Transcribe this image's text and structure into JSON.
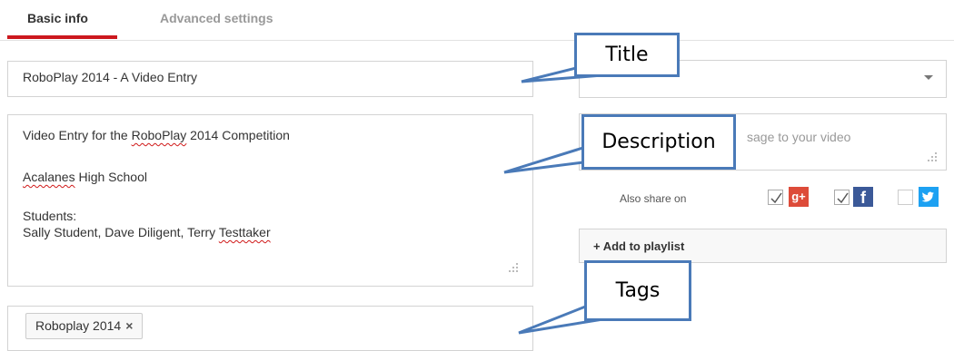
{
  "tabs": [
    {
      "label": "Basic info",
      "active": true
    },
    {
      "label": "Advanced settings",
      "active": false
    }
  ],
  "title_field": {
    "value": "RoboPlay 2014 - A Video Entry"
  },
  "description_field": {
    "line1_pre": "Video Entry for the ",
    "line1_mis": "RoboPlay",
    "line1_post": " 2014 Competition",
    "line2_mis": "Acalanes",
    "line2_post": " High School",
    "line3": "Students:",
    "line4_pre": "Sally Student, Dave Diligent, Terry ",
    "line4_mis": "Testtaker"
  },
  "tags_field": {
    "tags": [
      {
        "label": "Roboplay 2014",
        "remove_glyph": "×"
      }
    ]
  },
  "message_field": {
    "visible_placeholder_fragment": "sage to your video"
  },
  "share": {
    "label": "Also share on",
    "networks": [
      {
        "name": "google-plus",
        "checked": true,
        "glyph": "g+",
        "color": "#dd4b39"
      },
      {
        "name": "facebook",
        "checked": true,
        "glyph": "f",
        "color": "#3b5998"
      },
      {
        "name": "twitter",
        "checked": false,
        "color": "#1da1f2"
      }
    ]
  },
  "playlist_button": {
    "label": "+ Add to playlist"
  },
  "callouts": {
    "title": "Title",
    "description": "Description",
    "tags": "Tags"
  },
  "colors": {
    "tab_accent": "#cc181e",
    "callout_border": "#4a7ab8"
  }
}
